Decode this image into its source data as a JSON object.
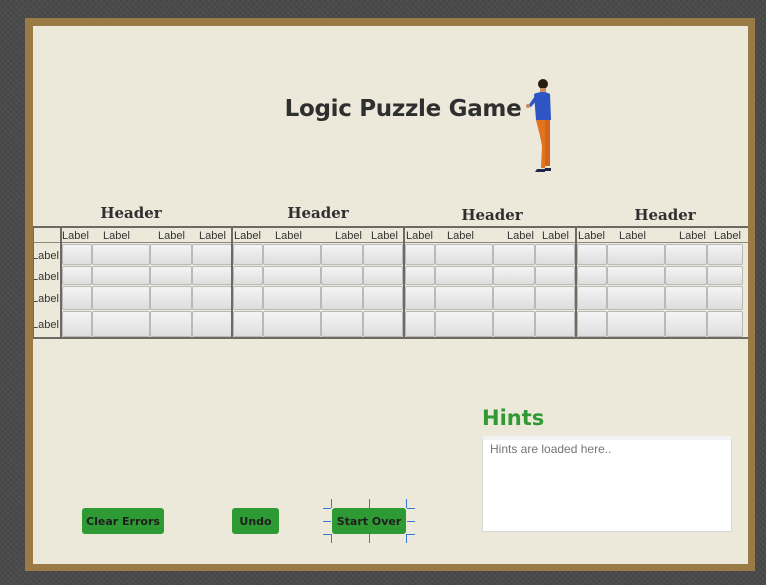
{
  "app": {
    "title": "Logic Puzzle Game"
  },
  "illustration": {
    "icon": "person-standing-icon"
  },
  "grid": {
    "headers": [
      "Header",
      "Header",
      "Header",
      "Header"
    ],
    "column_labels": [
      [
        "Label",
        "Label",
        "Label",
        "Label"
      ],
      [
        "Label",
        "Label",
        "Label",
        "Label"
      ],
      [
        "Label",
        "Label",
        "Label",
        "Label"
      ],
      [
        "Label",
        "Label",
        "Label",
        "Label"
      ]
    ],
    "row_labels": [
      "Label",
      "Label",
      "Label",
      "Label"
    ]
  },
  "hints": {
    "title": "Hints",
    "placeholder": "Hints are loaded here.."
  },
  "buttons": {
    "clear_errors": "Clear Errors",
    "undo": "Undo",
    "start_over": "Start Over"
  },
  "colors": {
    "accent": "#2e9a34",
    "frame": "#9a7a45",
    "background": "#ece8da"
  }
}
